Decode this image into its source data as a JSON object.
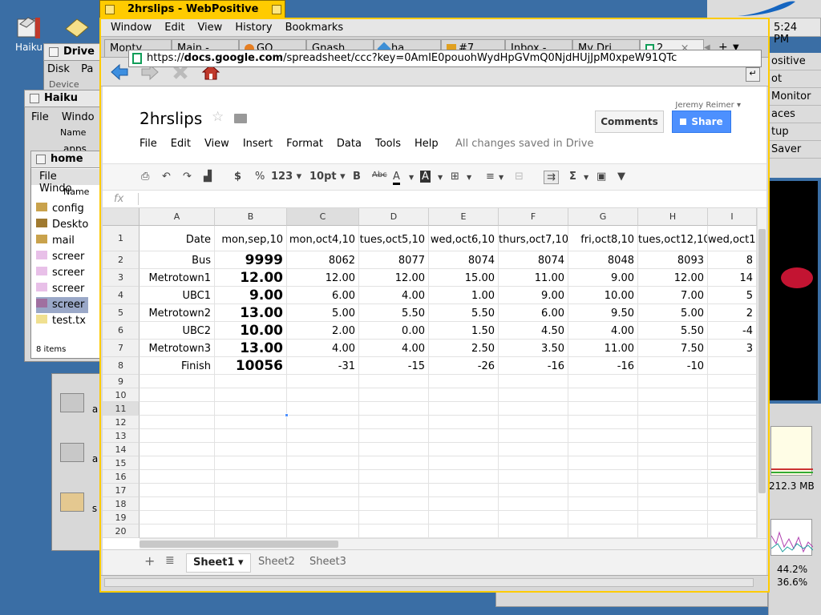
{
  "desktop": {
    "icons": [
      {
        "label": "Haiku"
      }
    ],
    "clock": "5:24 PM",
    "deskbar_items": [
      "ositive",
      "ot",
      "Monitor",
      "aces",
      "tup",
      "Saver"
    ],
    "tray": {
      "memory": "212.3 MB",
      "cpu1": "44.2%",
      "cpu2": "36.6%"
    }
  },
  "bg_windows": {
    "drive_title": "Drive",
    "drive_menu": [
      "Disk",
      "Pa"
    ],
    "drive_col": "Device",
    "haiku_title": "Haiku",
    "haiku_menu": [
      "File",
      "Windo"
    ],
    "haiku_col": "Name",
    "haiku_row": "apps",
    "home_title": "home",
    "home_menu": [
      "File",
      "Windo"
    ],
    "home_col": "Name",
    "home_items": [
      "config",
      "Deskto",
      "mail",
      "screer",
      "screer",
      "screer",
      "screer",
      "test.tx"
    ],
    "home_count": "8 items",
    "trans_items": [
      "a",
      "a",
      "s"
    ]
  },
  "browser": {
    "title": "2hrslips - WebPositive",
    "menu": [
      "Window",
      "Edit",
      "View",
      "History",
      "Bookmarks"
    ],
    "tabs": [
      {
        "label": "Monty ..."
      },
      {
        "label": "Main - ..."
      },
      {
        "label": "GO..."
      },
      {
        "label": "Gnash..."
      },
      {
        "label": "ha..."
      },
      {
        "label": "#7..."
      },
      {
        "label": "Inbox -..."
      },
      {
        "label": "My Dri..."
      },
      {
        "label": "2..."
      }
    ],
    "url_prefix": "https://",
    "url_domain": "docs.google.com",
    "url_rest": "/spreadsheet/ccc?key=0AmIE0pouohWydHpGVmQ0NjdHUjJpM0xpeW91QTc"
  },
  "doc": {
    "title": "2hrslips",
    "user": "Jeremy Reimer",
    "comments_label": "Comments",
    "share_label": "Share",
    "menu": [
      "File",
      "Edit",
      "View",
      "Insert",
      "Format",
      "Data",
      "Tools",
      "Help"
    ],
    "saved_status": "All changes saved in Drive",
    "toolbar": {
      "currency": "$",
      "percent": "%",
      "number_format": "123",
      "font_size": "10pt",
      "bold": "B",
      "strike": "Abc",
      "text_color": "A",
      "fill_color": "A",
      "sum": "Σ"
    },
    "fx_label": "fx"
  },
  "sheet": {
    "columns": [
      "A",
      "B",
      "C",
      "D",
      "E",
      "F",
      "G",
      "H",
      "I"
    ],
    "selected_column": "C",
    "selected_row": 11,
    "row_numbers": [
      1,
      2,
      3,
      4,
      5,
      6,
      7,
      8,
      9,
      10,
      11,
      12,
      13,
      14,
      15,
      16,
      17,
      18,
      19,
      20
    ],
    "rows": [
      [
        "Date",
        "mon,sep,10",
        "mon,oct4,10",
        "tues,oct5,10",
        "wed,oct6,10",
        "thurs,oct7,10",
        "fri,oct8,10",
        "tues,oct12,10",
        "wed,oct1"
      ],
      [
        "Bus",
        "9999",
        "8062",
        "8077",
        "8074",
        "8074",
        "8048",
        "8093",
        "8"
      ],
      [
        "Metrotown1",
        "12.00",
        "12.00",
        "12.00",
        "15.00",
        "11.00",
        "9.00",
        "12.00",
        "14"
      ],
      [
        "UBC1",
        "9.00",
        "6.00",
        "4.00",
        "1.00",
        "9.00",
        "10.00",
        "7.00",
        "5"
      ],
      [
        "Metrotown2",
        "13.00",
        "5.00",
        "5.50",
        "5.50",
        "6.00",
        "9.50",
        "5.00",
        "2"
      ],
      [
        "UBC2",
        "10.00",
        "2.00",
        "0.00",
        "1.50",
        "4.50",
        "4.00",
        "5.50",
        "-4"
      ],
      [
        "Metrotown3",
        "13.00",
        "4.00",
        "4.00",
        "2.50",
        "3.50",
        "11.00",
        "7.50",
        "3"
      ],
      [
        "Finish",
        "10056",
        "-31",
        "-15",
        "-26",
        "-16",
        "-16",
        "-10",
        ""
      ]
    ],
    "sheets": [
      "Sheet1",
      "Sheet2",
      "Sheet3"
    ],
    "active_sheet": "Sheet1"
  },
  "colors": {
    "accent_yellow": "#ffcb00",
    "share_blue": "#4d90fe",
    "desktop_blue": "#3a6ea5"
  }
}
